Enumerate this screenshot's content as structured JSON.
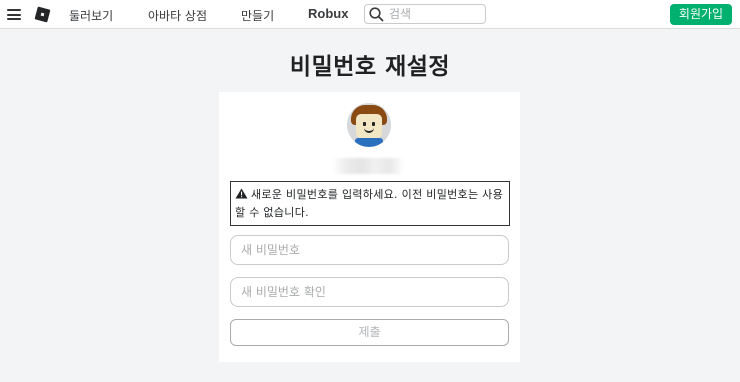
{
  "topbar": {
    "nav": [
      "둘러보기",
      "아바타 상점",
      "만들기",
      "Robux"
    ],
    "search_placeholder": "검색",
    "signup_label": "회원가입"
  },
  "page": {
    "title": "비밀번호 재설정"
  },
  "form": {
    "alert_text": "새로운 비밀번호를 입력하세요. 이전 비밀번호는 사용할 수 없습니다.",
    "new_password_placeholder": "새 비밀번호",
    "confirm_password_placeholder": "새 비밀번호 확인",
    "submit_label": "제출"
  },
  "colors": {
    "accent_green": "#00b06f",
    "background": "#f2f4f5"
  }
}
